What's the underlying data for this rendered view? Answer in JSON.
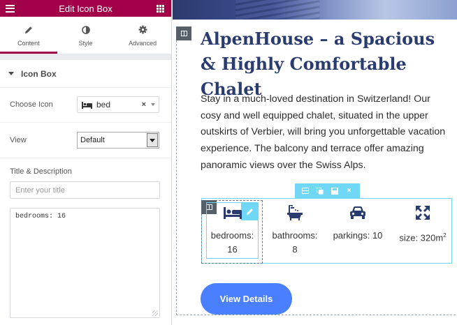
{
  "panel": {
    "title": "Edit Icon Box",
    "tabs": [
      {
        "label": "Content",
        "icon": "pencil-icon"
      },
      {
        "label": "Style",
        "icon": "half-circle-icon"
      },
      {
        "label": "Advanced",
        "icon": "gear-icon"
      }
    ],
    "section_title": "Icon Box",
    "choose_icon_label": "Choose Icon",
    "choose_icon_value": "bed",
    "view_label": "View",
    "view_value": "Default",
    "title_desc_label": "Title & Description",
    "title_placeholder": "Enter your title",
    "description_value": "bedrooms: 16",
    "accent": "#a3004a"
  },
  "canvas": {
    "heading": "AlpenHouse – a Spacious & Highly Comfortable Chalet",
    "paragraph": "Stay in a much-loved destination in Switzerland! Our cosy and well equipped chalet, situated in the upper outskirts of Verbier, will bring you unforgettable vacation experience. The balcony and terrace offer amazing panoramic views over the Swiss Alps.",
    "features": [
      {
        "icon": "bed-icon",
        "line1": "bedrooms:",
        "line2": "16"
      },
      {
        "icon": "bathtub-icon",
        "line1": "bathrooms:",
        "line2": "8"
      },
      {
        "icon": "car-icon",
        "line1": "parkings: 10",
        "line2": ""
      },
      {
        "icon": "expand-icon",
        "line1": "size: 320m",
        "sup": "2"
      }
    ],
    "button_label": "View Details",
    "heading_color": "#2a3b70",
    "button_color": "#4a80ff",
    "editor_highlight": "#71d7f7"
  }
}
